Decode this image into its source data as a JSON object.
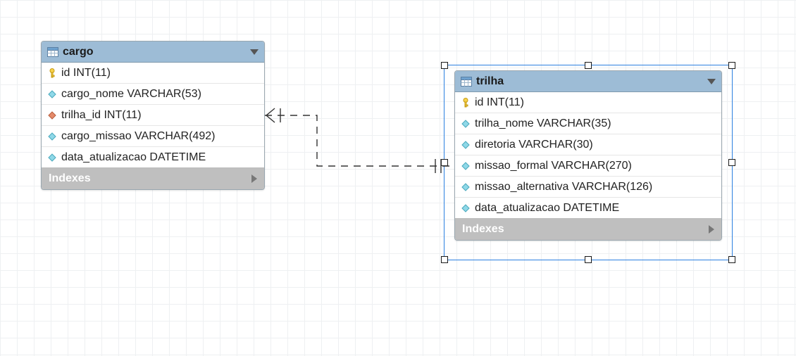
{
  "entities": {
    "cargo": {
      "title": "cargo",
      "indexes_label": "Indexes",
      "columns": [
        {
          "icon": "pk",
          "text": "id INT(11)"
        },
        {
          "icon": "col",
          "text": "cargo_nome VARCHAR(53)"
        },
        {
          "icon": "fk",
          "text": "trilha_id INT(11)"
        },
        {
          "icon": "col",
          "text": "cargo_missao VARCHAR(492)"
        },
        {
          "icon": "col",
          "text": "data_atualizacao DATETIME"
        }
      ]
    },
    "trilha": {
      "title": "trilha",
      "indexes_label": "Indexes",
      "columns": [
        {
          "icon": "pk",
          "text": "id INT(11)"
        },
        {
          "icon": "col",
          "text": "trilha_nome VARCHAR(35)"
        },
        {
          "icon": "col",
          "text": "diretoria VARCHAR(30)"
        },
        {
          "icon": "col",
          "text": "missao_formal VARCHAR(270)"
        },
        {
          "icon": "col",
          "text": "missao_alternativa VARCHAR(126)"
        },
        {
          "icon": "col",
          "text": "data_atualizacao DATETIME"
        }
      ]
    }
  },
  "chart_data": {
    "type": "erd",
    "tables": [
      {
        "name": "cargo",
        "columns": [
          {
            "name": "id",
            "type": "INT(11)",
            "pk": true
          },
          {
            "name": "cargo_nome",
            "type": "VARCHAR(53)"
          },
          {
            "name": "trilha_id",
            "type": "INT(11)",
            "fk": true,
            "references": "trilha.id"
          },
          {
            "name": "cargo_missao",
            "type": "VARCHAR(492)"
          },
          {
            "name": "data_atualizacao",
            "type": "DATETIME"
          }
        ]
      },
      {
        "name": "trilha",
        "columns": [
          {
            "name": "id",
            "type": "INT(11)",
            "pk": true
          },
          {
            "name": "trilha_nome",
            "type": "VARCHAR(35)"
          },
          {
            "name": "diretoria",
            "type": "VARCHAR(30)"
          },
          {
            "name": "missao_formal",
            "type": "VARCHAR(270)"
          },
          {
            "name": "missao_alternativa",
            "type": "VARCHAR(126)"
          },
          {
            "name": "data_atualizacao",
            "type": "DATETIME"
          }
        ]
      }
    ],
    "relationships": [
      {
        "from": "cargo.trilha_id",
        "to": "trilha.id",
        "cardinality": "many-to-one",
        "identifying": false
      }
    ]
  }
}
